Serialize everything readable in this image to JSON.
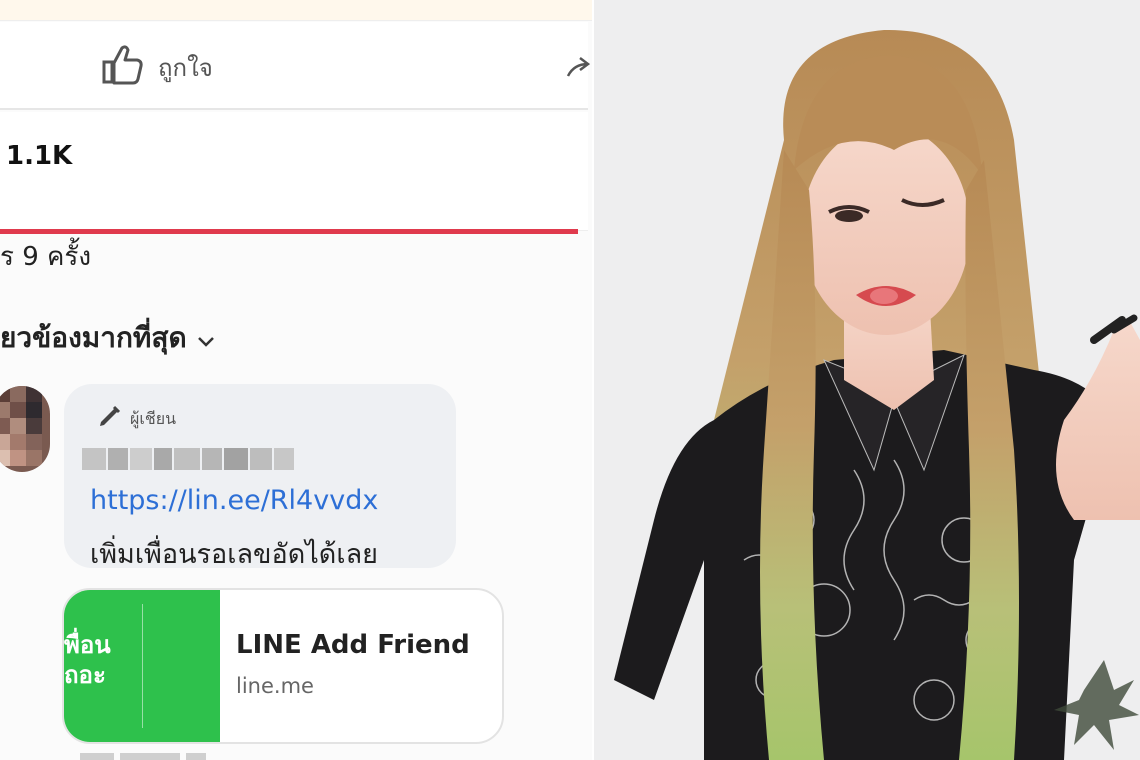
{
  "post": {
    "like_label": "ถูกใจ",
    "reaction_count": "1.1K",
    "shares_text": "ร 9 ครั้ง",
    "sort_label": "ยวข้องมากที่สุด"
  },
  "comment": {
    "author_badge": "ผู้เชียน",
    "link": "https://lin.ee/Rl4vvdx",
    "message": "เพิ่มเพื่อนรอเลขอัดได้เลย"
  },
  "link_preview": {
    "title": "LINE Add Friend",
    "domain": "line.me",
    "thumb_text_line1": "พื่อน",
    "thumb_text_line2": "ถอะ"
  },
  "colors": {
    "link_blue": "#2d6fd6",
    "line_green": "#2ec14c",
    "accent_red": "#e03a4d",
    "bubble_gray": "#eef0f3"
  },
  "icons": [
    "thumbs-up-icon",
    "share-icon",
    "chevron-down-icon",
    "pen-icon"
  ]
}
